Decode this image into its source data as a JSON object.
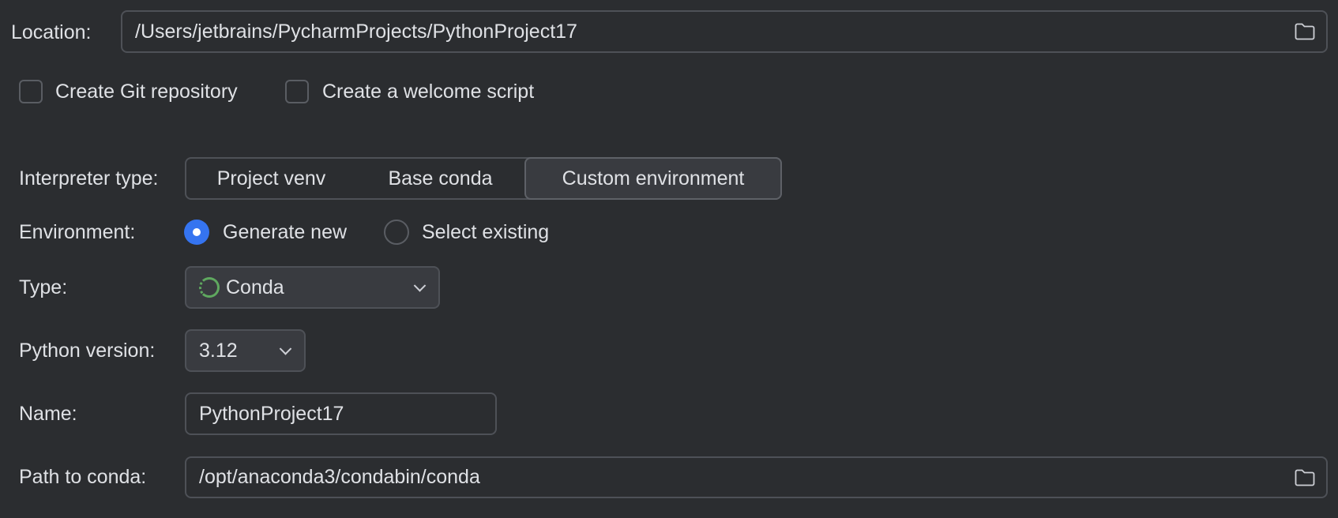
{
  "location": {
    "label": "Location:",
    "value": "/Users/jetbrains/PycharmProjects/PythonProject17"
  },
  "checkboxes": [
    {
      "label": "Create Git repository",
      "checked": false
    },
    {
      "label": "Create a welcome script",
      "checked": false
    }
  ],
  "interpreter": {
    "label": "Interpreter type:",
    "options": [
      "Project venv",
      "Base conda",
      "Custom environment"
    ],
    "selected": "Custom environment"
  },
  "environment": {
    "label": "Environment:",
    "options": [
      "Generate new",
      "Select existing"
    ],
    "selected": "Generate new"
  },
  "type": {
    "label": "Type:",
    "value": "Conda",
    "icon": "conda-icon"
  },
  "python_version": {
    "label": "Python version:",
    "value": "3.12"
  },
  "name": {
    "label": "Name:",
    "value": "PythonProject17"
  },
  "conda_path": {
    "label": "Path to conda:",
    "value": "/opt/anaconda3/condabin/conda"
  },
  "colors": {
    "background": "#2b2d30",
    "accent": "#3574f0",
    "conda_green": "#5fa85f"
  }
}
